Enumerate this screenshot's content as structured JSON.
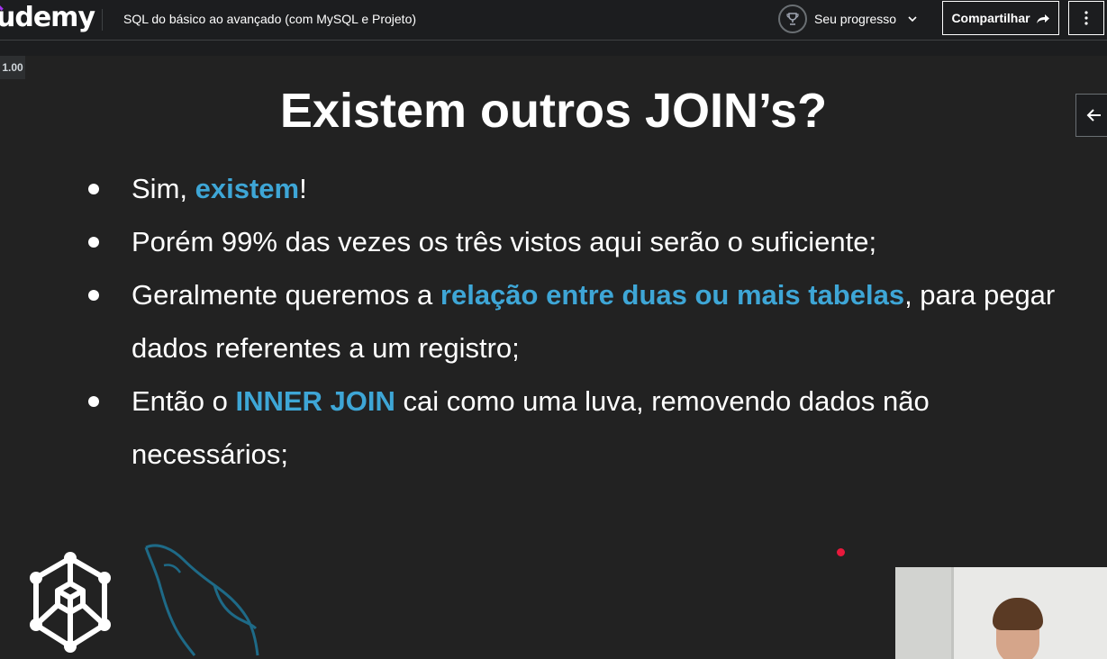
{
  "header": {
    "logo_text": "udemy",
    "course_title": "SQL do básico ao avançado (com MySQL e Projeto)",
    "progress_label": "Seu progresso",
    "share_label": "Compartilhar"
  },
  "player": {
    "speed": "1.00"
  },
  "slide": {
    "title": "Existem outros JOIN’s?",
    "bullets": [
      {
        "segments": [
          {
            "text": "Sim, ",
            "hl": false
          },
          {
            "text": "existem",
            "hl": true
          },
          {
            "text": "!",
            "hl": false
          }
        ]
      },
      {
        "segments": [
          {
            "text": "Porém 99% das vezes os três vistos aqui serão o suficiente;",
            "hl": false
          }
        ]
      },
      {
        "segments": [
          {
            "text": "Geralmente queremos a ",
            "hl": false
          },
          {
            "text": "relação entre duas ou mais tabelas",
            "hl": true
          },
          {
            "text": ", para pegar dados referentes a um registro;",
            "hl": false
          }
        ]
      },
      {
        "segments": [
          {
            "text": "Então o ",
            "hl": false
          },
          {
            "text": "INNER JOIN",
            "hl": true
          },
          {
            "text": " cai como uma luva, removendo dados não necessários;",
            "hl": false
          }
        ]
      }
    ]
  },
  "colors": {
    "highlight": "#3ea6d6",
    "brand_purple": "#a435f0",
    "record_dot": "#e8193c"
  },
  "icons": {
    "trophy": "trophy-icon",
    "share": "share-arrow-icon",
    "more": "kebab-menu-icon",
    "back": "arrow-left-icon"
  }
}
